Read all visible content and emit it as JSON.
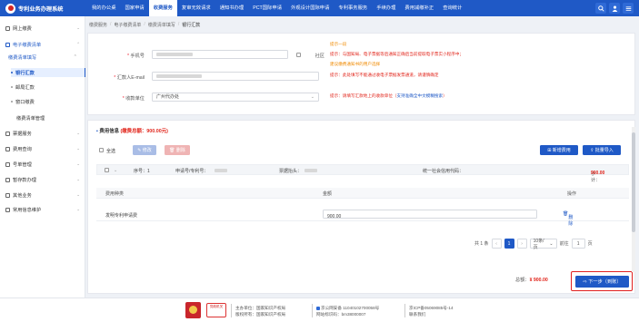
{
  "brand": {
    "name": "专利业务办理系统"
  },
  "nav": {
    "items": [
      "我的办公桌",
      "国家申请",
      "收费服务",
      "复审无效请求",
      "通知书办理",
      "PCT国际申请",
      "外观设计国际申请",
      "专利事务服务",
      "手续办理",
      "费用减缴补正",
      "查询统计"
    ],
    "active_index": 2
  },
  "sidebar": {
    "items": [
      "网上缴费",
      "电子缴费清单",
      "缴费清单填写",
      "银行汇款",
      "邮局汇款",
      "窗口缴费",
      "缴费清单管理",
      "票据服务",
      "费用查询",
      "号单管理",
      "暂存款办理",
      "其他业务",
      "常用信息维护"
    ]
  },
  "breadcrumb": [
    "缴费服务",
    "电子缴费清单",
    "缴费清单填写",
    "银行汇款"
  ],
  "form": {
    "phone_label": "手机号",
    "phone_value": "",
    "other_label": "社区",
    "email_label": "汇款人E-mail",
    "unit_label": "收款单位",
    "unit_value": "广州代办处",
    "tips": {
      "t1": "提示一段",
      "t2": "提示：与国知局、电子票据等后通知正确后当前提取电子票实小程序中；",
      "t3": "建议缴费通知书的用户选择",
      "t4": "提示：此处填写不能通过收电子票据发票通道，请谨慎确定",
      "t5_prefix": "提示：请填写汇款地上的收款单位（",
      "t5_link": "支持准确全中文模糊搜索",
      "t5_suffix": "）"
    }
  },
  "fee": {
    "title": "费用信息",
    "total_prefix": "(缴费总额：",
    "total_amount": "900.00元",
    "total_suffix": ")",
    "select_all": "全选",
    "edit_btn": "修改",
    "delete_btn": "删除",
    "add_fee_btn": "新增费用",
    "batch_import_btn": "批量导入",
    "strip": {
      "seq": "序号：1",
      "app_no": "申请号/专利号：",
      "invoice_title": "票据抬头：",
      "credit_code": "统一社会信用代码：",
      "subtotal_label": "小计：",
      "subtotal_value": "900.00"
    },
    "columns": [
      "费用种类",
      "金额",
      "操作"
    ],
    "rows": [
      {
        "type": "发明专利申请费",
        "amount": "900.00",
        "action": "删除"
      }
    ],
    "pager": {
      "total": "共 1 条",
      "current": "1",
      "page_size": "10条/页",
      "goto_label": "前往",
      "goto_value": "1",
      "page_unit": "页"
    },
    "sum_label": "总额：",
    "sum_value": "¥ 900.00",
    "next_btn": "下一步（到账）"
  },
  "footer": {
    "badge": "党政机关",
    "org": "主办单位：国家知识产权局",
    "rights": "版权所有：国家知识产权局",
    "police": "京公网安备 11040102700058号",
    "icp": "网站标识码：bm38000007",
    "icp2": "京ICP备05069085号-14",
    "contact": "联系我们"
  },
  "colors": {
    "primary": "#1f59c6",
    "danger": "#e1251b",
    "warning": "#f08a00"
  }
}
